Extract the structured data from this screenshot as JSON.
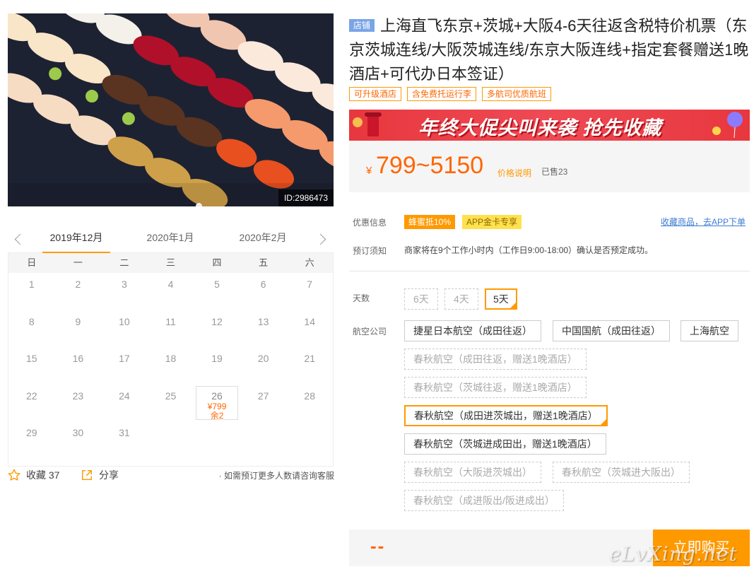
{
  "hero": {
    "id_label": "ID:2986473"
  },
  "calendar": {
    "tabs": [
      "2019年12月",
      "2020年1月",
      "2020年2月"
    ],
    "weekdays": [
      "日",
      "一",
      "二",
      "三",
      "四",
      "五",
      "六"
    ],
    "days": [
      "1",
      "2",
      "3",
      "4",
      "5",
      "6",
      "7",
      "8",
      "9",
      "10",
      "11",
      "12",
      "13",
      "14",
      "15",
      "16",
      "17",
      "18",
      "19",
      "20",
      "21",
      "22",
      "23",
      "24",
      "25",
      "26",
      "27",
      "28",
      "29",
      "30",
      "31"
    ],
    "highlight": {
      "day": "26",
      "price": "¥799",
      "remain": "余2"
    }
  },
  "share_bar": {
    "favorite_label": "收藏 37",
    "share_label": "分享",
    "note": "· 如需预订更多人数请咨询客服"
  },
  "product": {
    "shop_badge": "店铺",
    "title": "上海直飞东京+茨城+大阪4-6天往返含税特价机票（东京茨城连线/大阪茨城连线/东京大阪连线+指定套餐赠送1晚酒店+可代办日本签证）",
    "tags": [
      "可升级酒店",
      "含免费托运行李",
      "多航司优质航班"
    ],
    "promo_text": "年终大促尖叫来袭  抢先收藏",
    "price_symbol": "¥",
    "price": "799~5150",
    "price_explain": "价格说明",
    "sold": "已售23"
  },
  "info": {
    "discount_label": "优惠信息",
    "discount_tags": [
      "蜂蜜抵10%",
      "APP金卡专享"
    ],
    "fav_link": "收藏商品，去APP下单",
    "notice_label": "预订须知",
    "notice_text": "商家将在9个工作小时内（工作日9:00-18:00）确认是否预定成功。"
  },
  "options": {
    "days_label": "天数",
    "days": [
      "6天",
      "4天",
      "5天"
    ],
    "airline_label": "航空公司",
    "airlines": [
      "捷星日本航空（成田往返）",
      "中国国航（成田往返）",
      "上海航空",
      "春秋航空（成田往返，赠送1晚酒店）",
      "春秋航空（茨城往返，赠送1晚酒店）",
      "春秋航空（成田进茨城出，赠送1晚酒店）",
      "春秋航空（茨城进成田出，赠送1晚酒店）",
      "春秋航空（大阪进茨城出）",
      "春秋航空（茨城进大阪出）",
      "春秋航空（成进阪出/阪进成出）"
    ]
  },
  "buy": {
    "quantity": "--",
    "button": "立即购买",
    "watermark": "eLvXing.net"
  },
  "colors": {
    "accent": "#ff9900",
    "price": "#ff6600",
    "link": "#3b7bd4",
    "badge": "#7aa5e6",
    "promo": "#e8373e"
  }
}
